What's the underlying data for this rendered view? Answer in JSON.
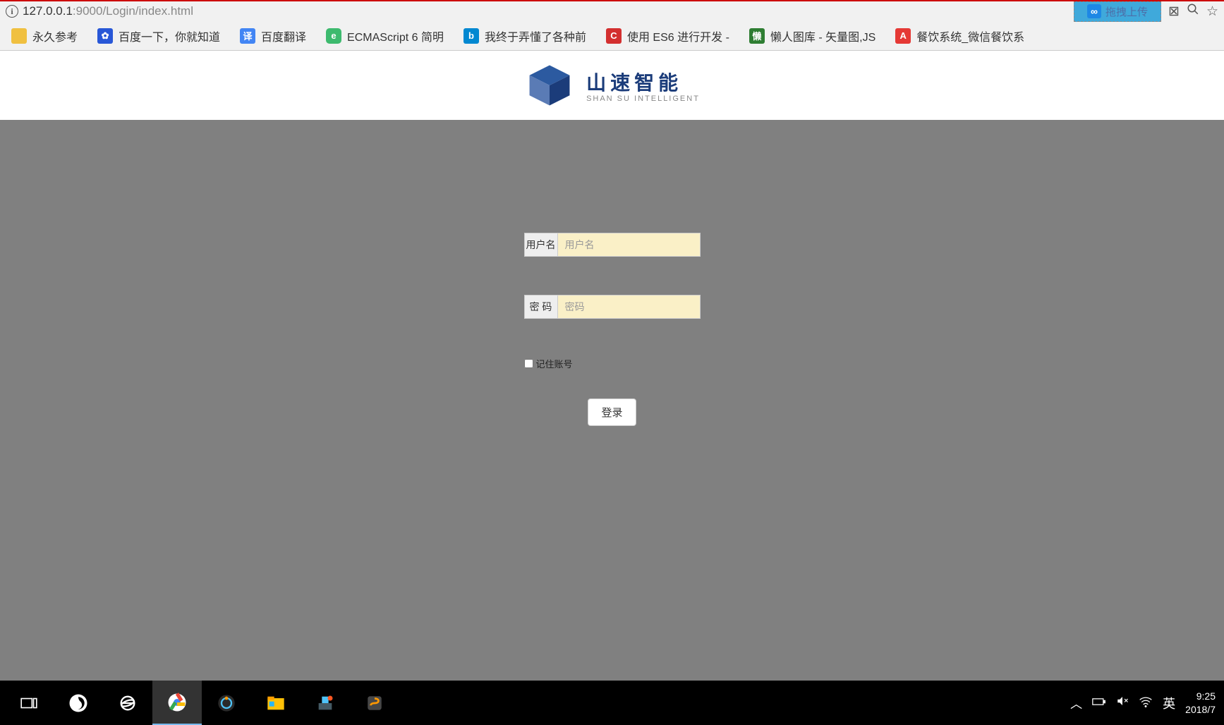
{
  "browser": {
    "url_host": "127.0.0.1",
    "url_port": ":9000",
    "url_path": "/Login/index.html",
    "upload_label": "拖拽上传"
  },
  "bookmarks": [
    {
      "label": "永久参考",
      "icon": "folder"
    },
    {
      "label": "百度一下，你就知道",
      "icon": "baidu"
    },
    {
      "label": "百度翻译",
      "icon": "trans"
    },
    {
      "label": "ECMAScript 6 简明",
      "icon": "ecma"
    },
    {
      "label": "我终于弄懂了各种前",
      "icon": "blue"
    },
    {
      "label": "使用 ES6 进行开发 -",
      "icon": "red"
    },
    {
      "label": "懒人图库 - 矢量图,JS",
      "icon": "green"
    },
    {
      "label": "餐饮系统_微信餐饮系",
      "icon": "redA"
    }
  ],
  "logo": {
    "zh": "山速智能",
    "en": "SHAN SU INTELLIGENT"
  },
  "login": {
    "username_label": "用户名",
    "username_placeholder": "用户名",
    "password_label": "密  码",
    "password_placeholder": "密码",
    "remember_label": "记住账号",
    "submit_label": "登录"
  },
  "taskbar": {
    "ime": "英",
    "time": "9:25",
    "date": "2018/7"
  }
}
